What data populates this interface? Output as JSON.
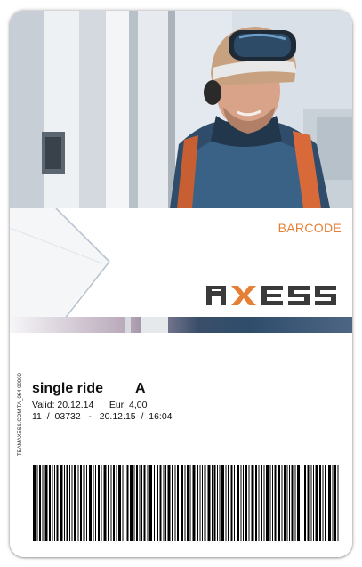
{
  "card": {
    "barcode_label": "BARCODE",
    "logo_text": "AXESS"
  },
  "ticket": {
    "print_code": "TEAMAXESS.COM TA_064 00000",
    "ride_name": "single ride",
    "ride_class": "A",
    "valid_label": "Valid:",
    "valid_date": "20.12.14",
    "currency": "Eur",
    "price": "4,00",
    "code_a": "11",
    "sep_1": "/",
    "code_b": "03732",
    "dash": "-",
    "end_date": "20.12.15",
    "sep_2": "/",
    "end_time": "16:04"
  },
  "colors": {
    "accent_orange": "#e57f35",
    "logo_dark": "#3a3a3a",
    "text": "#111111"
  }
}
